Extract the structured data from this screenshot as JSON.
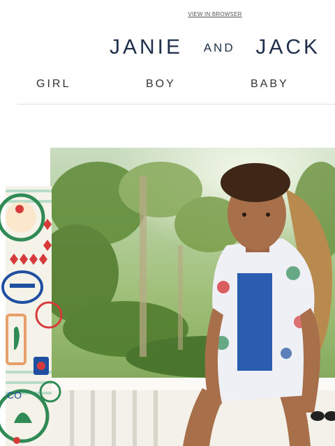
{
  "header": {
    "view_in_browser": "VIEW IN BROWSER"
  },
  "logo": {
    "word1": "JANIE",
    "word2": "AND",
    "word3": "JACK"
  },
  "nav": {
    "items": [
      {
        "label": "GIRL"
      },
      {
        "label": "BOY"
      },
      {
        "label": "BABY"
      }
    ]
  },
  "hero": {
    "pattern_text": "CO"
  },
  "colors": {
    "brand_navy": "#1f2e4a",
    "nav_text": "#333333",
    "pattern_green": "#2f8a55",
    "pattern_red": "#d63a3a",
    "pattern_blue": "#1e4fa0"
  }
}
